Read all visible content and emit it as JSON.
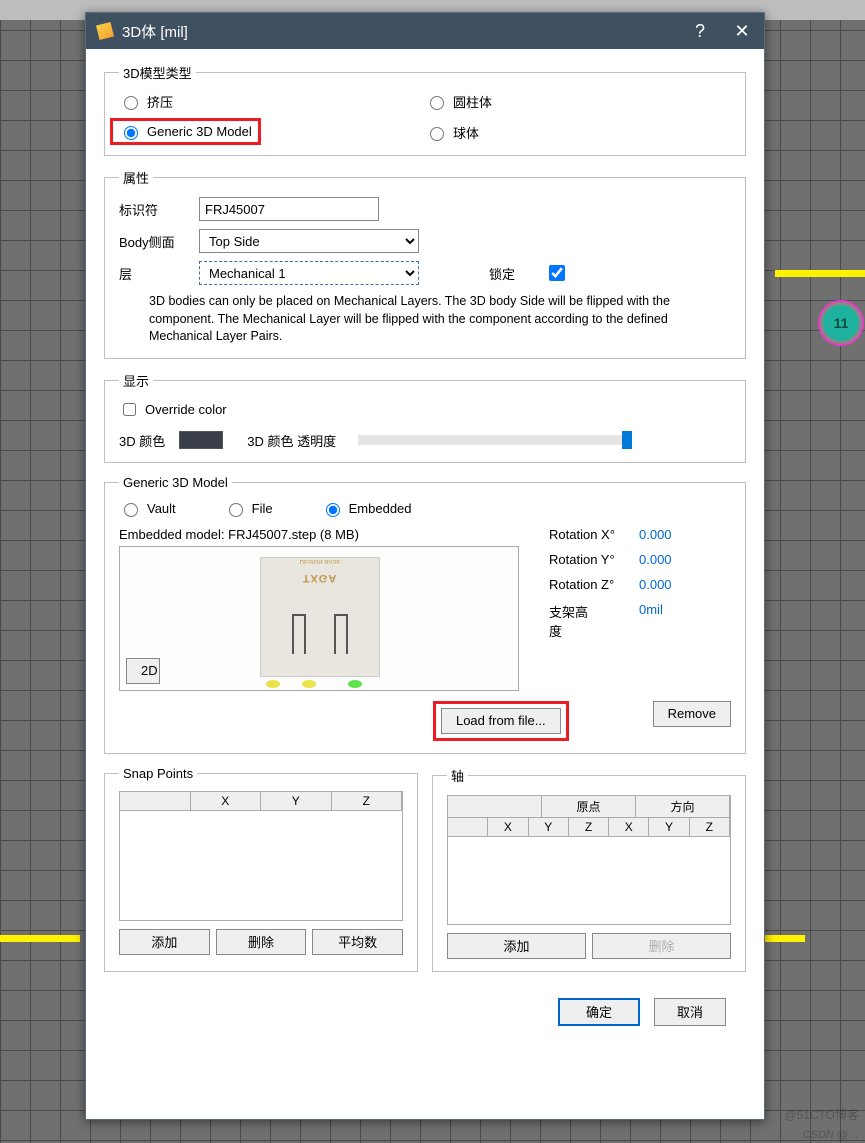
{
  "titlebar": {
    "title": "3D体 [mil]"
  },
  "type_group": {
    "legend": "3D模型类型",
    "extrude": "挤压",
    "cylinder": "圆柱体",
    "generic": "Generic 3D Model",
    "sphere": "球体"
  },
  "props": {
    "legend": "属性",
    "identifier_label": "标识符",
    "identifier_value": "FRJ45007",
    "side_label": "Body侧面",
    "side_value": "Top Side",
    "layer_label": "层",
    "layer_value": "Mechanical 1",
    "lock_label": "锁定",
    "helper": "3D bodies can only be placed on Mechanical Layers. The 3D body Side will be flipped with the component. The Mechanical Layer will be flipped with the component according to the defined Mechanical Layer Pairs."
  },
  "display": {
    "legend": "显示",
    "override": "Override color",
    "color3d_label": "3D 颜色",
    "opacity_label": "3D 颜色 透明度"
  },
  "model": {
    "legend": "Generic 3D Model",
    "src_vault": "Vault",
    "src_file": "File",
    "src_embedded": "Embedded",
    "embedded_label": "Embedded model:",
    "embedded_value": "FRJ45007.step (8 MB)",
    "brand": "TXGA",
    "d2": "2D",
    "rot_x_label": "Rotation X°",
    "rot_x": "0.000",
    "rot_y_label": "Rotation Y°",
    "rot_y": "0.000",
    "rot_z_label": "Rotation Z°",
    "rot_z": "0.000",
    "standoff_label": "支架高度",
    "standoff": "0mil",
    "load": "Load from file...",
    "remove": "Remove"
  },
  "snap": {
    "legend": "Snap Points",
    "col_x": "X",
    "col_y": "Y",
    "col_z": "Z",
    "add": "添加",
    "delete": "删除",
    "average": "平均数"
  },
  "axis": {
    "legend": "轴",
    "origin": "原点",
    "direction": "方向",
    "col_x": "X",
    "col_y": "Y",
    "col_z": "Z",
    "add": "添加",
    "delete": "删除"
  },
  "footer": {
    "ok": "确定",
    "cancel": "取消"
  },
  "bg": {
    "node11": "11"
  },
  "watermark": {
    "line1": "@51CTO博客",
    "line2": "CSDN @…"
  }
}
